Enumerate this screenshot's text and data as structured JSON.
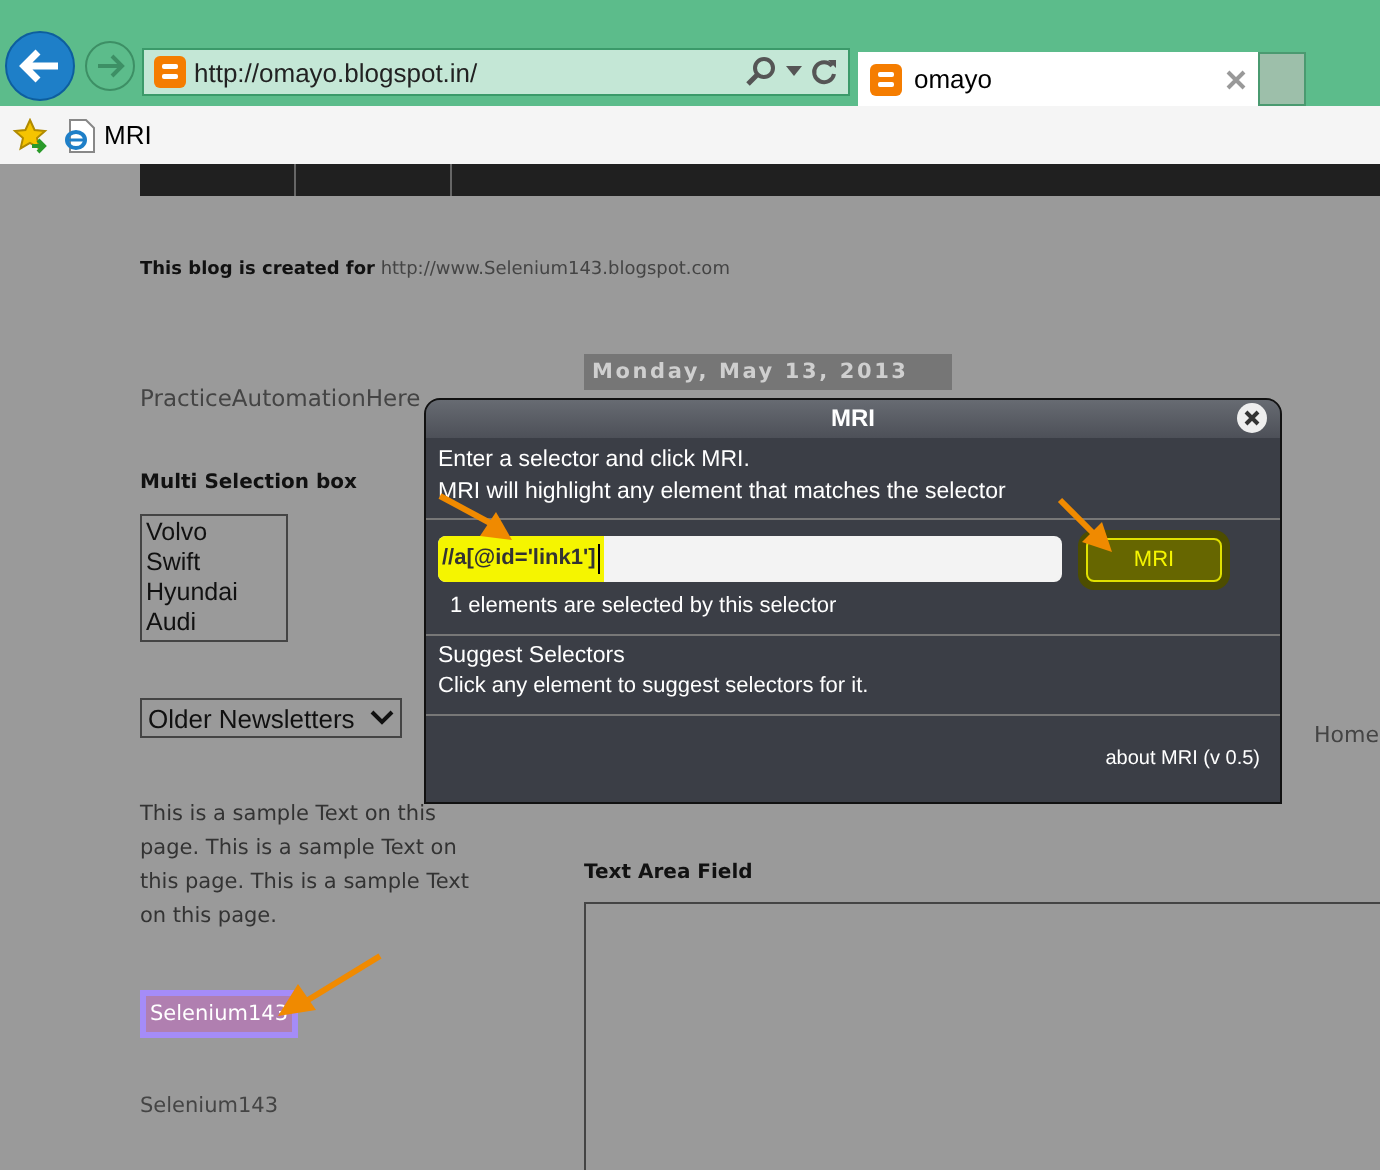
{
  "browser": {
    "address": "http://omayo.blogspot.in/",
    "tabs": [
      {
        "title": "omayo",
        "selected": true
      }
    ],
    "favorites": [
      {
        "label": "MRI"
      }
    ]
  },
  "page": {
    "intro": "**This blog is created for** http://www.Selenium143.blogspot.com",
    "date_header": "Monday, May 13, 2013",
    "sidebar": {
      "blog_title": "PracticeAutomationHere",
      "multi_select": {
        "label": "Multi Selection box",
        "options": [
          "Volvo",
          "Swift",
          "Hyundai",
          "Audi"
        ]
      },
      "dropdown": {
        "value": "Older Newsletters"
      },
      "paragraph": "This is a sample Text on this page. This is a sample Text on this page. This is a sample Text on this page.",
      "links": [
        {
          "text": "Selenium143",
          "highlighted": true
        },
        {
          "text": "Selenium143",
          "highlighted": false
        }
      ]
    },
    "home_link": "Home",
    "text_area": {
      "label": "Text Area Field"
    }
  },
  "dialog": {
    "title": "MRI",
    "instructions": [
      "Enter a selector and click MRI.",
      "MRI will highlight any element that matches the selector"
    ],
    "selector_field": {
      "value": "//a[@id='link1']"
    },
    "button": "MRI",
    "match_count": "1 elements are selected by this selector",
    "suggest": {
      "heading": "Suggest Selectors",
      "hint": "Click any element to suggest selectors for it."
    },
    "footer": "about MRI (v 0.5)"
  }
}
